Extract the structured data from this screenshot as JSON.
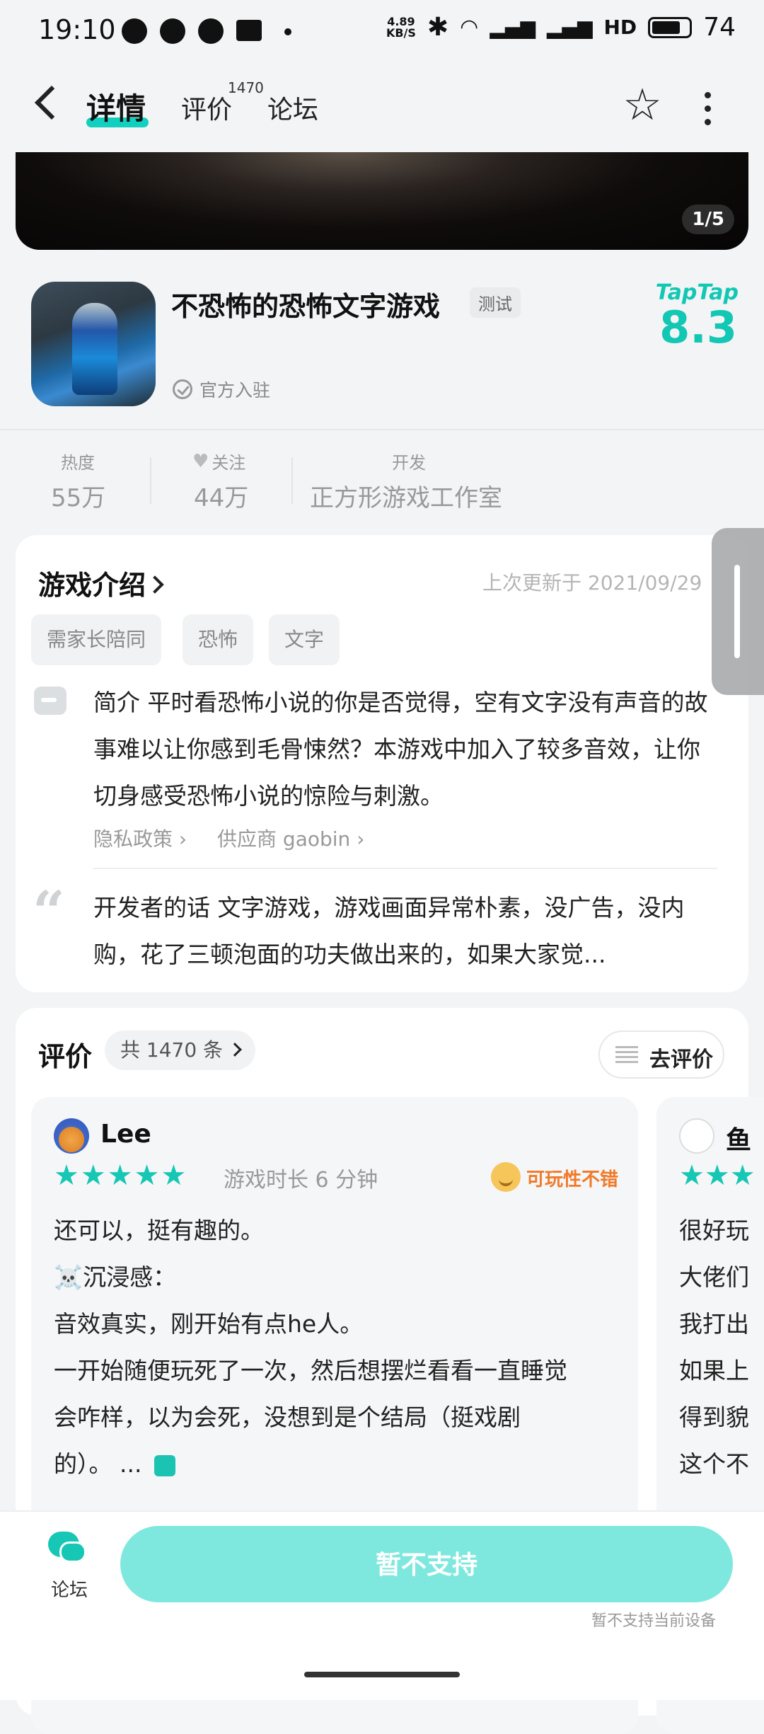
{
  "status_bar": {
    "time": "19:10",
    "net_speed_value": "4.89",
    "net_speed_unit": "KB/S",
    "network": "HD",
    "battery": "74"
  },
  "nav": {
    "tabs": [
      {
        "label": "详情"
      },
      {
        "label": "评价",
        "count": "1470"
      },
      {
        "label": "论坛"
      }
    ]
  },
  "banner": {
    "counter": "1/5"
  },
  "game": {
    "title": "不恐怖的恐怖文字游戏",
    "badge": "测试",
    "official": "官方入驻",
    "rating_source": "TapTap",
    "rating": "8.3"
  },
  "stats": [
    {
      "label": "热度",
      "value": "55万"
    },
    {
      "label": "关注",
      "value": "44万"
    },
    {
      "label": "开发",
      "value": "正方形游戏工作室"
    }
  ],
  "intro": {
    "title": "游戏介绍",
    "updated": "上次更新于 2021/09/29",
    "tags": [
      "需家长陪同",
      "恐怖",
      "文字"
    ],
    "description": "简介 平时看恐怖小说的你是否觉得，空有文字没有声音的故事难以让你感到毛骨悚然？本游戏中加入了较多音效，让你切身感受恐怖小说的惊险与刺激。",
    "privacy_link": "隐私政策",
    "supplier_link": "供应商 gaobin",
    "dev_words": "开发者的话 文字游戏，游戏画面异常朴素，没广告，没内购，花了三顿泡面的功夫做出来的，如果大家觉..."
  },
  "reviews": {
    "title": "评价",
    "count_label": "共 1470 条",
    "write_button": "去评价",
    "items": [
      {
        "user": "Lee",
        "stars": 5,
        "playtime": "游戏时长 6 分钟",
        "tag": "可玩性不错",
        "lines": [
          "还可以，挺有趣的。",
          "☠️沉浸感：",
          "音效真实，刚开始有点he人。",
          "一开始随便玩死了一次，然后想摆烂看看一直睡觉",
          "会咋样，以为会死，没想到是个结局（挺戏剧",
          "的）。 ..."
        ]
      },
      {
        "user": "鱼",
        "lines": [
          "很好玩",
          "大佬们",
          "我打出",
          "如果上",
          "得到貌",
          "这个不"
        ]
      }
    ]
  },
  "bottom": {
    "forum_label": "论坛",
    "cta": "暂不支持",
    "note": "暂不支持当前设备"
  }
}
